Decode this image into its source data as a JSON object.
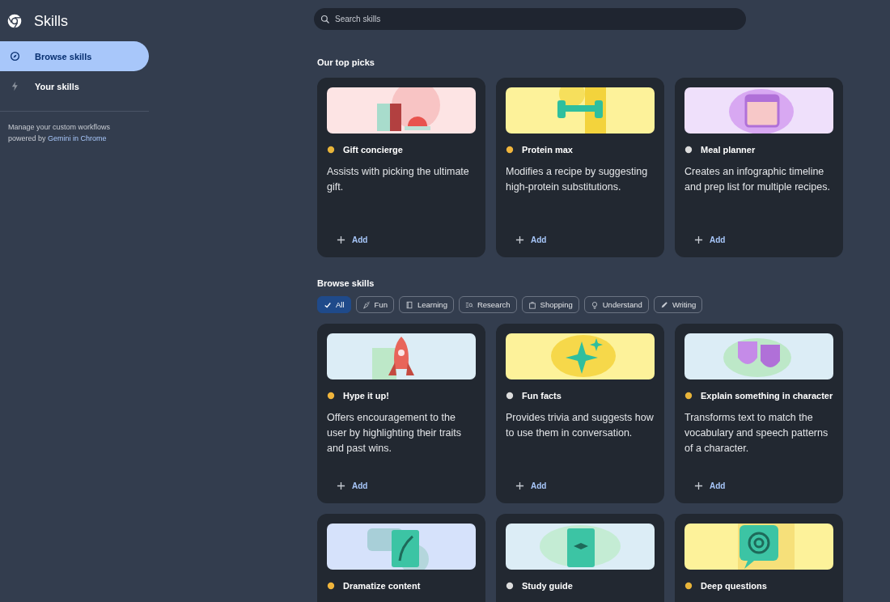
{
  "app": {
    "title": "Skills"
  },
  "nav": [
    {
      "label": "Browse skills",
      "kind": "compass",
      "selected": true
    },
    {
      "label": "Your skills",
      "kind": "bolt",
      "selected": false
    }
  ],
  "footer": {
    "text": "Manage your custom workflows powered by ",
    "link": "Gemini in Chrome"
  },
  "search": {
    "placeholder": "Search skills"
  },
  "top_picks": {
    "heading": "Our top picks",
    "cards": [
      {
        "title": "Gift concierge",
        "description": "Assists with picking the ultimate gift.",
        "action": "Add",
        "color": "#fde4e4",
        "kind": "gift"
      },
      {
        "title": "Protein max",
        "description": "Modifies a recipe by suggesting high-protein substitutions.",
        "action": "Add",
        "color": "#fdf29a",
        "kind": "dumbbell"
      },
      {
        "title": "Meal planner",
        "description": "Creates an infographic timeline and prep list for multiple recipes.",
        "action": "Add",
        "color": "#efe0fb",
        "kind": "calendar"
      }
    ]
  },
  "browse": {
    "heading": "Browse skills",
    "filters": [
      {
        "label": "All",
        "selected": true
      },
      {
        "label": "Fun",
        "selected": false
      },
      {
        "label": "Learning",
        "selected": false
      },
      {
        "label": "Research",
        "selected": false
      },
      {
        "label": "Shopping",
        "selected": false
      },
      {
        "label": "Understand",
        "selected": false
      },
      {
        "label": "Writing",
        "selected": false
      }
    ],
    "cards": [
      {
        "title": "Hype it up!",
        "description": "Offers encouragement to the user by highlighting their traits and past wins.",
        "action": "Add",
        "color": "#dcedf6",
        "kind": "rocket"
      },
      {
        "title": "Fun facts",
        "description": "Provides trivia and suggests how to use them in conversation.",
        "action": "Add",
        "color": "#fdf29a",
        "kind": "sparkle"
      },
      {
        "title": "Explain something in character",
        "description": "Transforms text to match the vocabulary and speech patterns of a character.",
        "action": "Add",
        "color": "#dcedf6",
        "kind": "masks"
      },
      {
        "title": "Dramatize content",
        "color": "#d6e2fb",
        "kind": "quill"
      },
      {
        "title": "Study guide",
        "color": "#dcedf6",
        "kind": "doc"
      },
      {
        "title": "Deep questions",
        "color": "#fdf29a",
        "kind": "spiral"
      }
    ]
  }
}
